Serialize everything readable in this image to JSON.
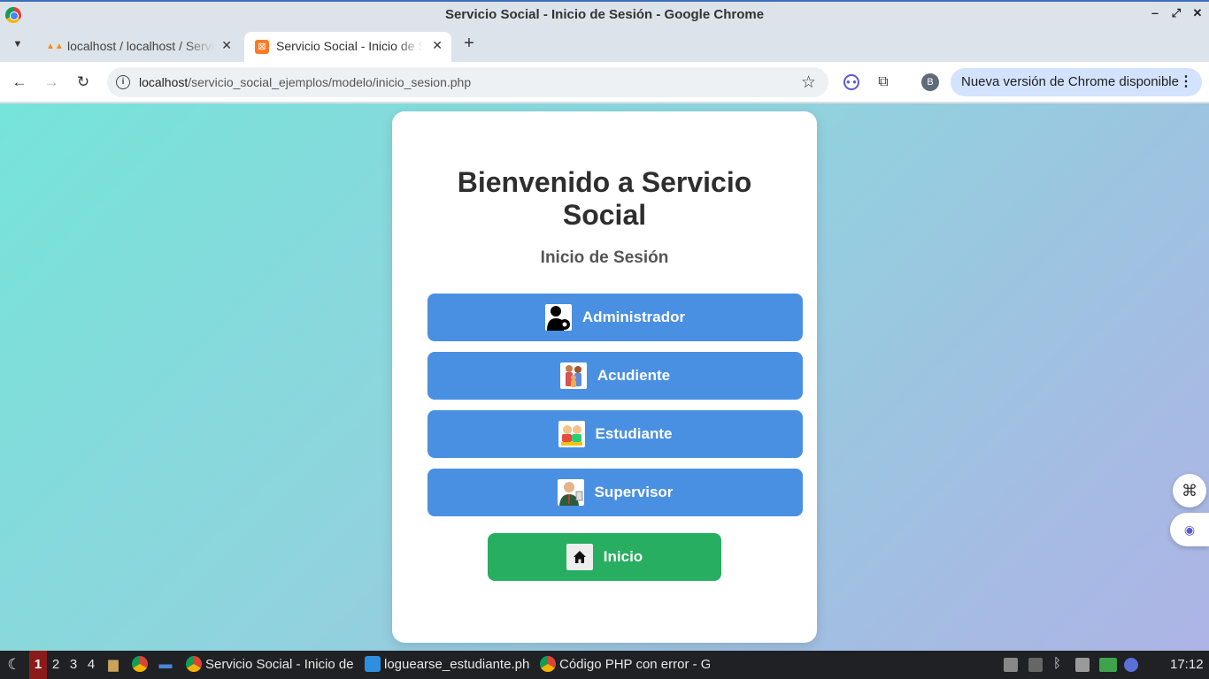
{
  "window": {
    "title": "Servicio Social - Inicio de Sesión - Google Chrome",
    "minimize_glyph": "‒",
    "maximize_glyph": "⤢",
    "close_glyph": "✕"
  },
  "tabs": [
    {
      "label": "localhost / localhost / Servicio Social",
      "icon": "phpmyadmin-icon",
      "close": "✕"
    },
    {
      "label": "Servicio Social - Inicio de Sesión",
      "icon": "xampp-icon",
      "close": "✕",
      "active": true
    }
  ],
  "new_tab_glyph": "+",
  "toolbar": {
    "url_host": "localhost",
    "url_path": "/servicio_social_ejemplos/modelo/inicio_sesion.php",
    "profile_initial": "B",
    "update_label": "Nueva versión de Chrome disponible"
  },
  "page": {
    "heading": "Bienvenido a Servicio Social",
    "subtitle": "Inicio de Sesión",
    "roles": [
      {
        "label": "Administrador",
        "icon": "admin-gear-icon"
      },
      {
        "label": "Acudiente",
        "icon": "family-icon"
      },
      {
        "label": "Estudiante",
        "icon": "students-icon"
      },
      {
        "label": "Supervisor",
        "icon": "supervisor-icon"
      }
    ],
    "home_label": "Inicio",
    "colors": {
      "role_button": "#4a90e2",
      "home_button": "#27ae60",
      "card": "#ffffff"
    }
  },
  "taskbar": {
    "workspaces": [
      "1",
      "2",
      "3",
      "4"
    ],
    "tasks": [
      {
        "label": "Servicio Social - Inicio de Sesión",
        "icon": "chrome-icon"
      },
      {
        "label": "loguearse_estudiante.php",
        "icon": "vscode-icon"
      },
      {
        "label": "Código PHP con error - Google Chrome",
        "icon": "chrome-icon"
      }
    ],
    "clock": "17:12"
  }
}
